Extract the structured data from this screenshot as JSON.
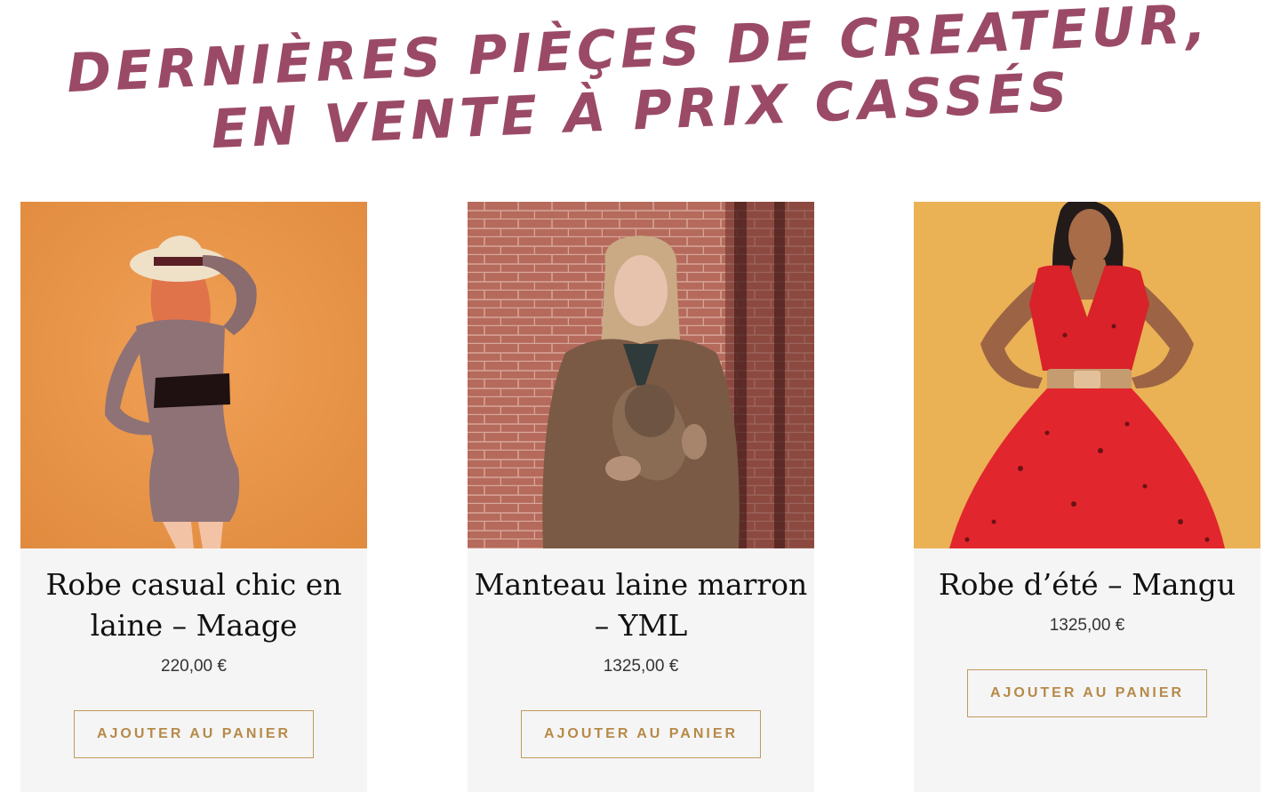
{
  "headline": {
    "line1": "DERNIÈRES PIÈÇES DE CREATEUR,",
    "line2": "EN VENTE À PRIX CASSÉS"
  },
  "products": [
    {
      "title": "Robe casual chic en laine – Maage",
      "price": "220,00 €",
      "button": "AJOUTER AU PANIER"
    },
    {
      "title": "Manteau laine marron – YML",
      "price": "1325,00 €",
      "button": "AJOUTER AU PANIER"
    },
    {
      "title": "Robe d’été – Mangu",
      "price": "1325,00 €",
      "button": "AJOUTER AU PANIER"
    }
  ],
  "colors": {
    "headline": "#9a4a67",
    "button": "#b68a48",
    "card_background": "#f5f5f5"
  }
}
